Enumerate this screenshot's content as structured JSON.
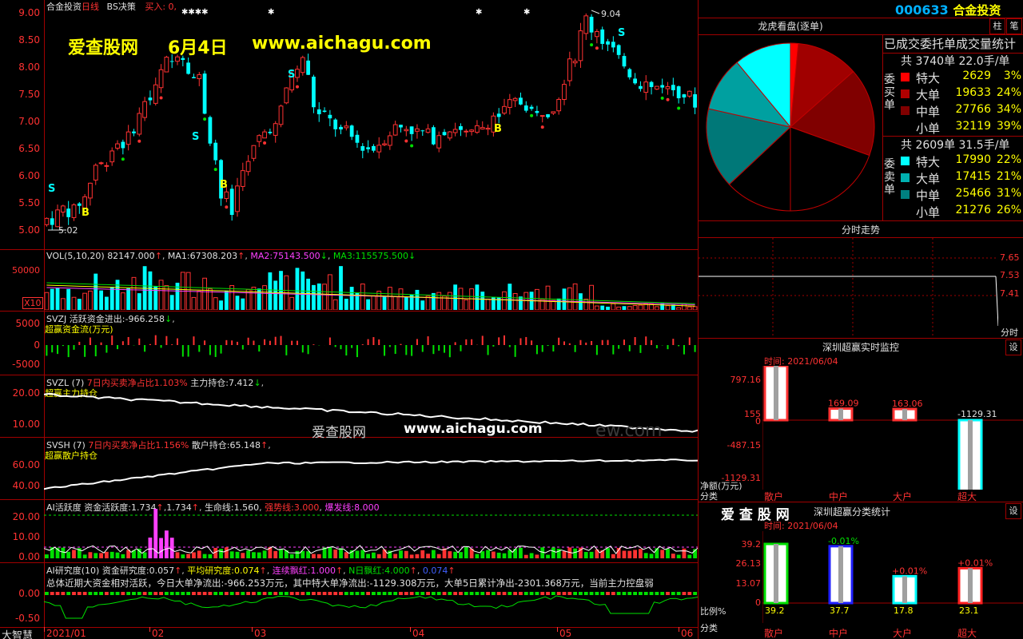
{
  "header": {
    "stock_name": "合金投资",
    "period": "日线",
    "strategy": "BS决策",
    "buy_label": "买入: 0,",
    "code": "000633",
    "title_name": "合金投资"
  },
  "watermark": {
    "site_name": "爱查股网",
    "date": "6月4日",
    "url": "www.aichagu.com",
    "center_name": "爱查股网",
    "center_url": "www.aichagu.com",
    "faded_text": "ew.com"
  },
  "main_chart": {
    "y_ticks": [
      "9.00",
      "8.50",
      "8.00",
      "7.50",
      "7.00",
      "6.50",
      "6.00",
      "5.50",
      "5.00"
    ],
    "high_marker": "9.04",
    "low_marker": "5.02",
    "signal_s": "S",
    "signal_b": "B",
    "stars": "✱✱✱✱"
  },
  "vol_panel": {
    "name": "VOL(5,10,20)",
    "value": "82147.000",
    "ma1_label": "MA1:",
    "ma1": "67308.203",
    "ma2_label": "MA2:",
    "ma2": "75143.500",
    "ma3_label": "MA3:",
    "ma3": "115575.500",
    "y_tick": "50000",
    "unit": "X10"
  },
  "svzj_panel": {
    "name": "SVZJ",
    "label": "活跃资金进出:",
    "value": "-966.258",
    "sublabel": "超赢资金流(万元)",
    "y_ticks": [
      "5000",
      "0",
      "-5000"
    ]
  },
  "svzl_panel": {
    "name": "SVZL",
    "param": "(7)",
    "label1": "7日内买卖净占比1.103%",
    "label2": "主力持仓:",
    "value": "7.412",
    "sublabel": "超赢主力持仓",
    "y_ticks": [
      "20.00",
      "10.00"
    ]
  },
  "svsh_panel": {
    "name": "SVSH",
    "param": "(7)",
    "label1": "7日内买卖净占比1.156%",
    "label2": "散户持仓:",
    "value": "65.148",
    "sublabel": "超赢散户持仓",
    "y_ticks": [
      "60.00",
      "40.00"
    ]
  },
  "ai_active_panel": {
    "name": "AI活跃度",
    "label": "资金活跃度:",
    "value": "1.734",
    "value2": "1.734",
    "life_label": "生命线:",
    "life": "1.560",
    "strong_label": "强势线:",
    "strong": "3.000",
    "burst_label": "爆发线:",
    "burst": "8.000",
    "y_ticks": [
      "20.00",
      "10.00",
      "0.00"
    ]
  },
  "ai_research_panel": {
    "name": "AI研究度(10)",
    "label": "资金研究度:",
    "value": "0.057",
    "avg_label": "平均研究度:",
    "avg": "0.074",
    "cont_label": "连续飘红:",
    "cont": "1.000",
    "n_label": "N日飘红:",
    "n": "4.000",
    "extra": "0.074",
    "summary": "总体近期大资金相对活跃，今日大单净流出:-966.253万元，其中特大单净流出:-1129.308万元，大单5日累计净出-2301.368万元，当前主力控盘弱",
    "y_ticks": [
      "0.00",
      "-0.50"
    ]
  },
  "bottom_axis": {
    "brand": "大智慧",
    "months": [
      "2021/01",
      "02",
      "03",
      "04",
      "05",
      "06"
    ]
  },
  "right_panel": {
    "buttons": [
      "柱",
      "笔"
    ],
    "lhb_title": "龙虎看盘(逐单)",
    "stats_title": "已成交委托单成交量统计",
    "buy_total": "共 3740单 22.0手/单",
    "buy_side_label": "委买单",
    "buy_rows": [
      {
        "label": "特大",
        "count": "2629",
        "pct": "3%",
        "color": "#ff0000"
      },
      {
        "label": "大单",
        "count": "19633",
        "pct": "24%",
        "color": "#b00000"
      },
      {
        "label": "中单",
        "count": "27766",
        "pct": "34%",
        "color": "#800000"
      },
      {
        "label": "小单",
        "count": "32119",
        "pct": "39%",
        "color": "#000000"
      }
    ],
    "sell_total": "共 2609单 31.5手/单",
    "sell_side_label": "委卖单",
    "sell_rows": [
      {
        "label": "特大",
        "count": "17990",
        "pct": "22%",
        "color": "#00ffff"
      },
      {
        "label": "大单",
        "count": "17415",
        "pct": "21%",
        "color": "#00b0b0"
      },
      {
        "label": "中单",
        "count": "25466",
        "pct": "31%",
        "color": "#008080"
      },
      {
        "label": "小单",
        "count": "21276",
        "pct": "26%",
        "color": "#000000"
      }
    ],
    "pie_slices": [
      {
        "name": "buy-special",
        "value": 3,
        "color": "#ff0000"
      },
      {
        "name": "buy-large",
        "value": 24,
        "color": "#a00000"
      },
      {
        "name": "buy-medium",
        "value": 34,
        "color": "#800000"
      },
      {
        "name": "buy-small",
        "value": 39,
        "color": "#000000"
      },
      {
        "name": "sell-small",
        "value": 26,
        "color": "#000000"
      },
      {
        "name": "sell-medium",
        "value": 31,
        "color": "#007878"
      },
      {
        "name": "sell-large",
        "value": 21,
        "color": "#00a0a0"
      },
      {
        "name": "sell-special",
        "value": 22,
        "color": "#00ffff"
      }
    ],
    "intraday_title": "分时走势",
    "intraday_ticks": [
      "7.65",
      "7.53",
      "7.41"
    ],
    "intraday_label": "分时",
    "monitor_title": "深圳超赢实时监控",
    "monitor_btn": "设",
    "monitor_time": "时间: 2021/06/04",
    "monitor_y_ticks": [
      "797.16",
      "155",
      "0",
      "-487.15",
      "-1129.31"
    ],
    "monitor_unit": "净额(万元)",
    "monitor_cat_label": "分类",
    "monitor_bars": [
      {
        "cat": "散户",
        "value": 797.16,
        "label": "797.16"
      },
      {
        "cat": "中户",
        "value": 169.09,
        "label": "169.09"
      },
      {
        "cat": "大户",
        "value": 163.06,
        "label": "163.06"
      },
      {
        "cat": "超大",
        "value": -1129.31,
        "label": "-1129.31"
      }
    ],
    "class_brand": "爱 查 股 网",
    "class_title": "深圳超赢分类统计",
    "class_btn": "设",
    "class_time": "时间: 2021/06/04",
    "class_y_ticks": [
      "39.2",
      "26.13",
      "13.07",
      "0"
    ],
    "class_unit": "比例%",
    "class_cat_label": "分类",
    "class_bars": [
      {
        "cat": "散户",
        "value": 39.2,
        "label": "39.2",
        "delta": ""
      },
      {
        "cat": "中户",
        "value": 37.7,
        "label": "37.7",
        "delta": "-0.01%"
      },
      {
        "cat": "大户",
        "value": 17.8,
        "label": "17.8",
        "delta": "+0.01%"
      },
      {
        "cat": "超大",
        "value": 23.1,
        "label": "23.1",
        "delta": "+0.01%"
      }
    ]
  },
  "colors": {
    "up": "#ff3232",
    "down": "#00ffff",
    "border": "#a00000",
    "yellow": "#ffff00"
  }
}
